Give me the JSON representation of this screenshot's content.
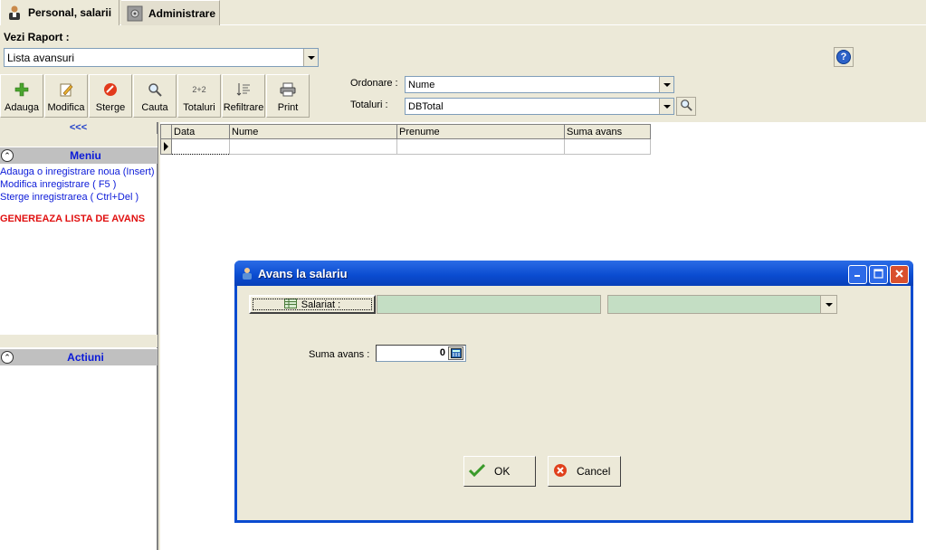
{
  "tabs": [
    {
      "label": "Personal, salarii",
      "icon": "person-icon"
    },
    {
      "label": "Administrare",
      "icon": "gear-icon"
    }
  ],
  "raport": {
    "label": "Vezi Raport :",
    "selected": "Lista avansuri"
  },
  "help": {
    "glyph": "?"
  },
  "toolbar": {
    "buttons": [
      {
        "label": "Adauga",
        "icon": "plus-icon"
      },
      {
        "label": "Modifica",
        "icon": "edit-icon"
      },
      {
        "label": "Sterge",
        "icon": "delete-icon"
      },
      {
        "label": "Cauta",
        "icon": "magnifier-icon"
      },
      {
        "label": "Totaluri",
        "icon": "sum-icon",
        "glyph": "2+2"
      },
      {
        "label": "Refiltrare",
        "icon": "filter-icon"
      },
      {
        "label": "Print",
        "icon": "printer-icon"
      }
    ]
  },
  "ordonare": {
    "label": "Ordonare :",
    "value": "Nume"
  },
  "totaluri": {
    "label": "Totaluri :",
    "value": "DBTotal"
  },
  "leftpanel": {
    "collapse": "<<<",
    "meniu_title": "Meniu",
    "items": [
      "Adauga o inregistrare noua (Insert)",
      "Modifica inregistrare ( F5 )",
      "Sterge inregistrarea ( Ctrl+Del )"
    ],
    "generate": "GENEREAZA LISTA DE AVANS",
    "actiuni_title": "Actiuni"
  },
  "grid": {
    "columns": [
      "Data",
      "Nume",
      "Prenume",
      "Suma avans"
    ]
  },
  "dialog": {
    "title": "Avans la salariu",
    "salariat_label": "Salariat :",
    "suma_label": "Suma avans :",
    "suma_value": "0",
    "ok_label": "OK",
    "cancel_label": "Cancel"
  },
  "colors": {
    "xp_face": "#ECE9D8",
    "title_blue": "#0A4BD0",
    "menu_blue": "#0b1ad8",
    "alert_red": "#e01010",
    "field_green": "#C4DEC4"
  }
}
